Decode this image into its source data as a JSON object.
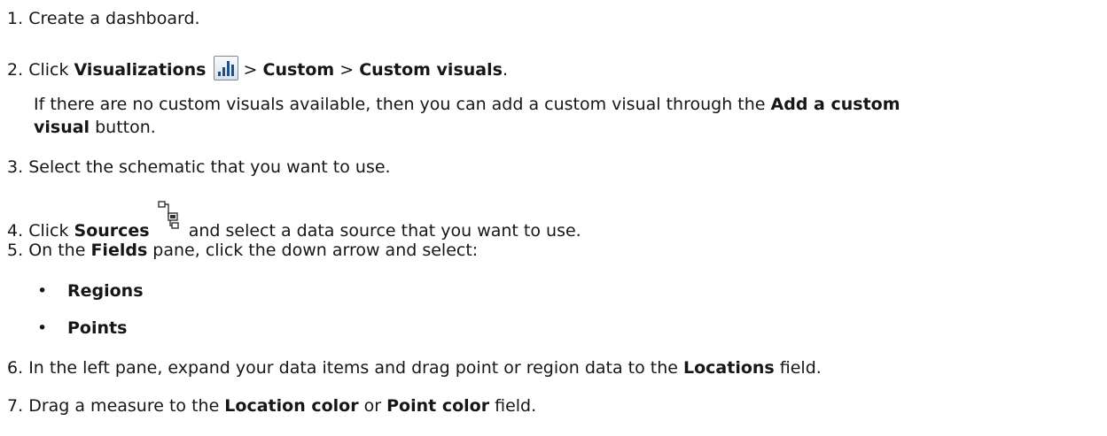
{
  "steps": [
    {
      "num": "1.",
      "text": "Create a dashboard."
    },
    {
      "num": "2.",
      "pre": "Click ",
      "b1": "Visualizations",
      "mid": " > ",
      "b2": "Custom",
      "mid2": " > ",
      "b3": "Custom visuals",
      "post": "."
    },
    {
      "note_pre": "If there are no custom visuals available, then you can add a custom visual through the ",
      "note_b": "Add a custom",
      "note_b2": "visual",
      "note_post": " button."
    },
    {
      "num": "3.",
      "text": "Select the schematic that you want to use."
    },
    {
      "num": "4.",
      "pre": "Click ",
      "b1": "Sources",
      "post": " and select a data source that you want to use."
    },
    {
      "num": "5.",
      "pre": "On the ",
      "b1": "Fields",
      "post": " pane, click the down arrow and select:"
    },
    {
      "num": "6.",
      "pre": "In the left pane, expand your data items and drag point or region data to the ",
      "b1": "Locations",
      "post": " field."
    },
    {
      "num": "7.",
      "pre": "Drag a measure to the ",
      "b1": "Location color",
      "mid": " or ",
      "b2": "Point color",
      "post": " field."
    }
  ],
  "bullets": [
    "Regions",
    "Points"
  ],
  "bullet_char": "•",
  "icons": {
    "visualizations": "bar-chart-icon",
    "sources": "data-source-tree-icon"
  },
  "colors": {
    "text": "#161616",
    "icon_bar": "#1f4e8c"
  }
}
